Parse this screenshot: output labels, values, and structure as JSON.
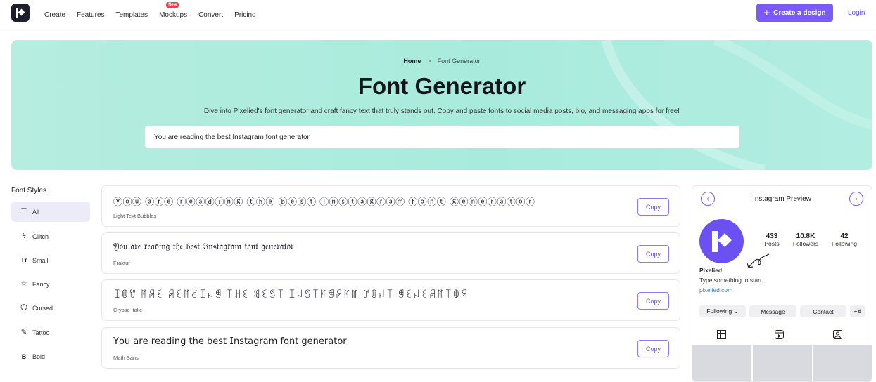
{
  "nav": {
    "links": [
      "Create",
      "Features",
      "Templates",
      "Mockups",
      "Convert",
      "Pricing"
    ],
    "new_badge": "New",
    "create_button": "Create a design",
    "login": "Login"
  },
  "hero": {
    "breadcrumb_home": "Home",
    "breadcrumb_sep": ">",
    "breadcrumb_current": "Font Generator",
    "title": "Font Generator",
    "subtitle": "Dive into Pixelied's font generator and craft fancy text that truly stands out. Copy and paste fonts to social media posts, bio, and messaging apps for free!",
    "input_value": "You are reading the best Instagram font generator"
  },
  "sidebar": {
    "title": "Font Styles",
    "items": [
      {
        "label": "All",
        "icon": "list-icon"
      },
      {
        "label": "Glitch",
        "icon": "bolt-icon"
      },
      {
        "label": "Small",
        "icon": "text-size-icon"
      },
      {
        "label": "Fancy",
        "icon": "star-icon"
      },
      {
        "label": "Cursed",
        "icon": "face-icon"
      },
      {
        "label": "Tattoo",
        "icon": "tattoo-icon"
      },
      {
        "label": "Bold",
        "icon": "bold-icon"
      }
    ]
  },
  "fonts": [
    {
      "text": "Ⓨⓞⓤ ⓐⓡⓔ ⓡⓔⓐⓓⓘⓝⓖ ⓣⓗⓔ ⓑⓔⓢⓣ Ⓘⓝⓢⓣⓐⓖⓡⓐⓜ ⓕⓞⓝⓣ ⓖⓔⓝⓔⓡⓐⓣⓞⓡ",
      "name": "Light Text Bubbles",
      "copy": "Copy"
    },
    {
      "text": "𝔜𝔬𝔲 𝔞𝔯𝔢 𝔯𝔢𝔞𝔡𝔦𝔫𝔤 𝔱𝔥𝔢 𝔟𝔢𝔰𝔱 ℑ𝔫𝔰𝔱𝔞𝔤𝔯𝔞𝔪 𝔣𝔬𝔫𝔱 𝔤𝔢𝔫𝔢𝔯𝔞𝔱𝔬𝔯",
      "name": "Fraktur",
      "copy": "Copy"
    },
    {
      "text": "ꀤꂦꀎ ꍏꋪꏂ ꋪꏂꍏꀸꀤꈤꁅ ꓄ꃅꏂ ꌃꏂꌗ꓄ ꀤꈤꌗ꓄ꍏꁅꋪꍏꂵ ꎇꂦꈤ꓄ ꁅꏂꈤꏂꋪꍏ꓄ꂦꋪ",
      "name": "Cryptic Italic",
      "copy": "Copy"
    },
    {
      "text": "𝖸𝗈𝗎 𝖺𝗋𝖾 𝗋𝖾𝖺𝖽𝗂𝗇𝗀 𝗍𝗁𝖾 𝖻𝖾𝗌𝗍 𝖨𝗇𝗌𝗍𝖺𝗀𝗋𝖺𝗆 𝖿𝗈𝗇𝗍 𝗀𝖾𝗇𝖾𝗋𝖺𝗍𝗈𝗋",
      "name": "Math Sans",
      "copy": "Copy"
    }
  ],
  "instagram": {
    "title": "Instagram Preview",
    "prev": "‹",
    "next": "›",
    "stats": [
      {
        "num": "433",
        "label": "Posts"
      },
      {
        "num": "10.8K",
        "label": "Followers"
      },
      {
        "num": "42",
        "label": "Following"
      }
    ],
    "name": "Pixelied",
    "bio": "Type something to start",
    "link": "pixelied.com",
    "buttons": [
      "Following ⌄",
      "Message",
      "Contact",
      "+ꓤ"
    ]
  },
  "colors": {
    "accent": "#7a5af8",
    "hero_bg": "#aeecdf",
    "active_side": "#ecebf8",
    "badge": "#ef3e4a"
  }
}
